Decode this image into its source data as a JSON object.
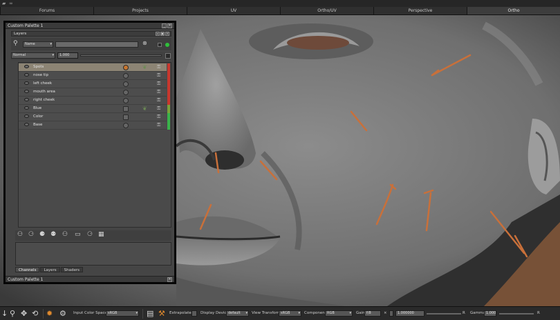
{
  "viewport_tabs": [
    {
      "label": "Forums",
      "active": false
    },
    {
      "label": "Projects",
      "active": false
    },
    {
      "label": "UV",
      "active": false
    },
    {
      "label": "Ortho/UV",
      "active": false
    },
    {
      "label": "Perspective",
      "active": false
    },
    {
      "label": "Ortho",
      "active": true
    }
  ],
  "palette": {
    "title": "Custom Palette 1",
    "footer_title": "Custom Palette 1",
    "layers_header": "Layers",
    "blend_mode": "Normal",
    "search_mode": "Name",
    "opacity_value": "1.000",
    "layers": [
      {
        "name": "Spots",
        "selected": true,
        "mode": "orange",
        "extra": true,
        "bar": "#c8372d"
      },
      {
        "name": "nose tip",
        "selected": false,
        "mode": "grey",
        "extra": false,
        "bar": "#c8372d"
      },
      {
        "name": "left cheek",
        "selected": false,
        "mode": "grey",
        "extra": false,
        "bar": "#c8372d"
      },
      {
        "name": "mouth area",
        "selected": false,
        "mode": "grey",
        "extra": false,
        "bar": "#c8372d"
      },
      {
        "name": "right cheek",
        "selected": false,
        "mode": "grey",
        "extra": false,
        "bar": "#c8372d"
      },
      {
        "name": "Blue",
        "selected": false,
        "mode": "square",
        "extra": true,
        "bar": "#7aa23a"
      },
      {
        "name": "Color",
        "selected": false,
        "mode": "square",
        "extra": false,
        "bar": "#39b34a"
      },
      {
        "name": "Base",
        "selected": false,
        "mode": "grey",
        "extra": false,
        "bar": "#39b34a"
      }
    ],
    "tabs": [
      {
        "label": "Channels",
        "active": true
      },
      {
        "label": "Layers",
        "active": false
      },
      {
        "label": "Shaders",
        "active": false
      }
    ]
  },
  "bottombar": {
    "input_color_space_label": "Input Color Space",
    "input_color_space_value": "sRGB",
    "extrapolate_label": "Extrapolate",
    "display_device_label": "Display Device",
    "display_device_value": "default",
    "view_transform_label": "View Transform",
    "view_transform_value": "sRGB",
    "component_label": "Component",
    "component_value": "RGB",
    "gain_label": "Gain",
    "gain_value": "f/8",
    "exposure_value": "1.000000",
    "gamma_label": "Gamma",
    "gamma_value": "1.000"
  },
  "colors": {
    "accent_orange": "#c7762f",
    "stroke_orange": "#c9703a"
  }
}
